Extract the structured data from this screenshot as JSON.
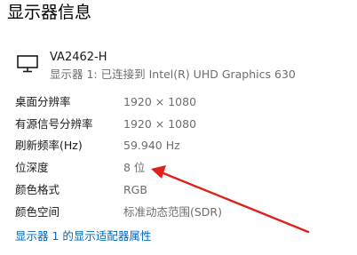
{
  "page_title": "显示器信息",
  "display": {
    "name": "VA2462-H",
    "connection": "显示器 1: 已连接到 Intel(R) UHD Graphics 630",
    "icon": "monitor-icon"
  },
  "info": [
    {
      "label": "桌面分辨率",
      "value": "1920 × 1080"
    },
    {
      "label": "有源信号分辨率",
      "value": "1920 × 1080"
    },
    {
      "label": "刷新频率(Hz)",
      "value": "59.940 Hz"
    },
    {
      "label": "位深度",
      "value": "8 位"
    },
    {
      "label": "颜色格式",
      "value": "RGB"
    },
    {
      "label": "颜色空间",
      "value": "标准动态范围(SDR)"
    }
  ],
  "adapter_link": "显示器 1 的显示适配器属性",
  "colors": {
    "link": "#0067c0",
    "annotation_arrow": "#e0201b",
    "secondary_text": "#6d6d6d"
  }
}
